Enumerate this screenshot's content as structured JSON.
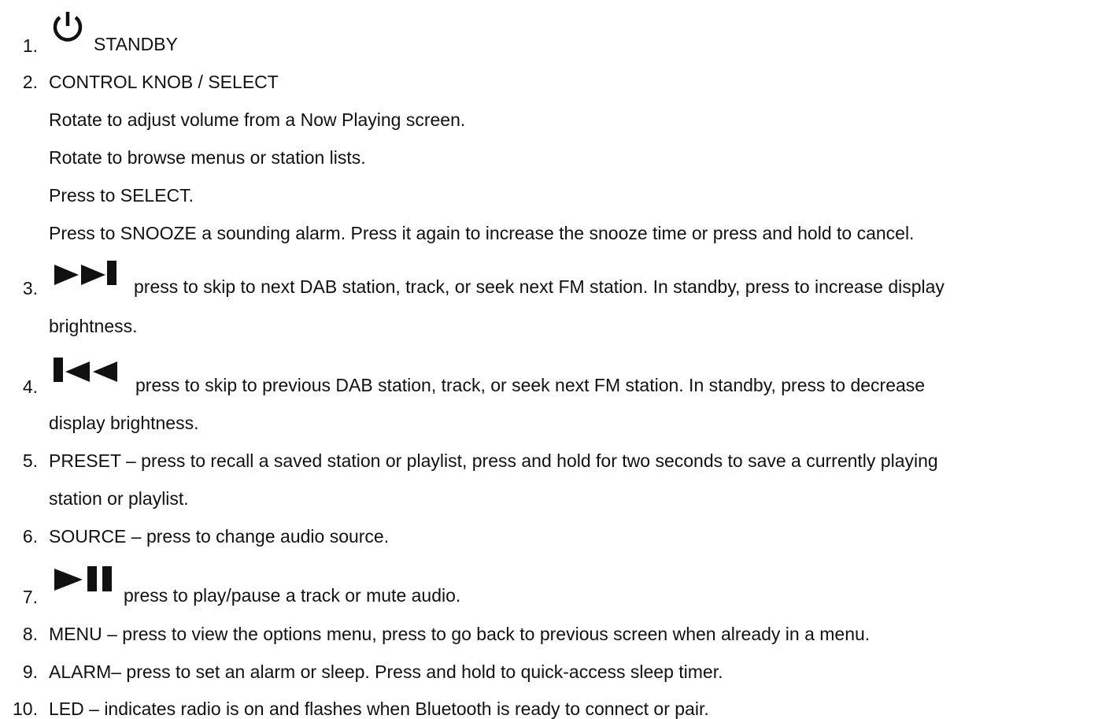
{
  "items": [
    {
      "number": "1.",
      "label": "STANDBY",
      "icon": "power-icon"
    },
    {
      "number": "2.",
      "title": "CONTROL KNOB / SELECT",
      "lines": [
        "Rotate to adjust volume from a Now Playing screen.",
        "Rotate to browse menus or station lists.",
        "Press to SELECT.",
        "Press to SNOOZE a sounding alarm. Press it again to increase the snooze time or press and hold to cancel."
      ]
    },
    {
      "number": "3.",
      "icon": "skip-next-icon",
      "text_1": "press to skip to next DAB station, track, or seek next FM station. In standby, press to increase display",
      "text_2": "brightness."
    },
    {
      "number": "4.",
      "icon": "skip-previous-icon",
      "text_1": "press to skip to previous DAB station, track, or seek next FM station. In standby, press to decrease",
      "text_2": "display brightness."
    },
    {
      "number": "5.",
      "text_1": "PRESET – press to recall a saved station or playlist, press and hold for two seconds to save a currently playing",
      "text_2": "station or playlist."
    },
    {
      "number": "6.",
      "text_1": "SOURCE – press to change audio source."
    },
    {
      "number": "7.",
      "icon": "play-pause-icon",
      "text_1": "press to play/pause a track or mute audio."
    },
    {
      "number": "8.",
      "text_1": "MENU – press to view the options menu, press to go back to previous screen when already in a menu."
    },
    {
      "number": "9.",
      "text_1": "ALARM– press to set an alarm or sleep. Press and hold to quick-access sleep timer."
    },
    {
      "number": "10.",
      "text_1": "LED – indicates radio is on and flashes when Bluetooth is ready to connect or pair."
    }
  ]
}
